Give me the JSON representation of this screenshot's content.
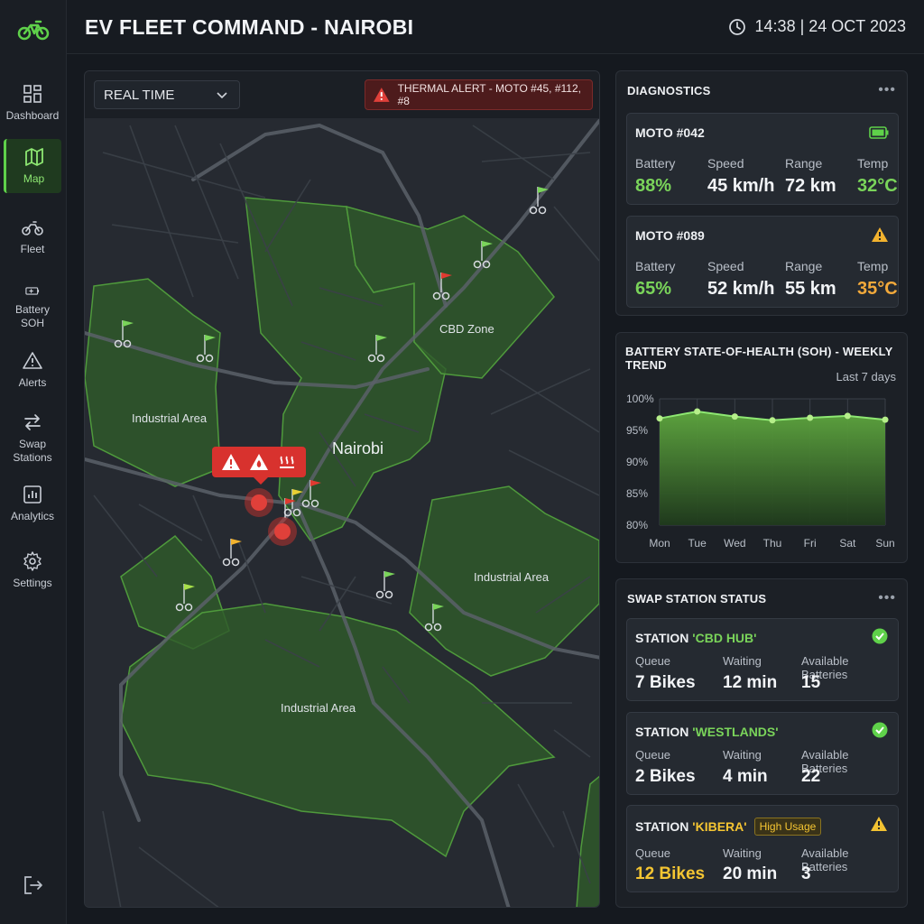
{
  "header": {
    "title": "EV FLEET COMMAND - NAIROBI",
    "clock": "14:38 | 24 OCT 2023"
  },
  "sidebar": {
    "items": [
      {
        "label": "Dashboard",
        "icon": "dashboard-icon"
      },
      {
        "label": "Map",
        "icon": "map-icon",
        "active": true
      },
      {
        "label": "Fleet",
        "icon": "motorcycle-icon"
      },
      {
        "label": "Battery SOH",
        "icon": "battery-icon"
      },
      {
        "label": "Alerts",
        "icon": "warning-icon"
      },
      {
        "label": "Swap\nStations",
        "icon": "swap-icon"
      },
      {
        "label": "Analytics",
        "icon": "analytics-icon"
      },
      {
        "label": "Settings",
        "icon": "gear-icon"
      }
    ]
  },
  "map": {
    "mode_select": "REAL TIME",
    "thermal_alert": "THERMAL ALERT - MOTO #45, #112, #8",
    "labels": {
      "cbd_zone": "CBD Zone",
      "industrial_west": "Industrial Area",
      "nairobi": "Nairobi",
      "industrial_east": "Industrial Area",
      "industrial_south": "Industrial Area"
    }
  },
  "diagnostics": {
    "title": "DIAGNOSTICS",
    "more": "•••",
    "labels": {
      "battery": "Battery",
      "speed": "Speed",
      "range": "Range",
      "temp": "Temp"
    },
    "vehicles": [
      {
        "name": "MOTO #042",
        "battery": "88%",
        "speed": "45 km/h",
        "range": "72 km",
        "temp": "32°C",
        "status_icon": "battery-full-icon"
      },
      {
        "name": "MOTO #089",
        "battery": "65%",
        "speed": "52 km/h",
        "range": "55 km",
        "temp": "35°C",
        "status_icon": "warning-icon"
      }
    ]
  },
  "soh_chart": {
    "title": "BATTERY STATE-OF-HEALTH (SOH) - WEEKLY TREND",
    "period": "Last 7 days"
  },
  "chart_data": {
    "type": "area",
    "title": "BATTERY STATE-OF-HEALTH (SOH) - WEEKLY TREND",
    "categories": [
      "Mon",
      "Tue",
      "Wed",
      "Thu",
      "Fri",
      "Sat",
      "Sun"
    ],
    "values": [
      96.9,
      98.0,
      97.2,
      96.6,
      97.0,
      97.3,
      96.7
    ],
    "yticks": [
      "100%",
      "95%",
      "90%",
      "85%",
      "80%"
    ],
    "ylim": [
      80,
      100
    ],
    "grid": true,
    "color": "#7ad45a"
  },
  "swap_stations": {
    "title": "SWAP STATION STATUS",
    "more": "•••",
    "labels": {
      "queue": "Queue",
      "waiting": "Waiting",
      "available": "Available Batteries"
    },
    "stations": [
      {
        "prefix": "STATION ",
        "name": "'CBD HUB'",
        "queue": "7 Bikes",
        "waiting": "12 min",
        "available": "15",
        "status_icon": "check-circle-icon",
        "badge": ""
      },
      {
        "prefix": "STATION ",
        "name": "'WESTLANDS'",
        "queue": "2 Bikes",
        "waiting": "4 min",
        "available": "22",
        "status_icon": "check-circle-icon",
        "badge": ""
      },
      {
        "prefix": "STATION ",
        "name": "'KIBERA'",
        "queue": "12 Bikes",
        "waiting": "20 min",
        "available": "3",
        "status_icon": "warning-icon",
        "badge": "High Usage"
      }
    ]
  },
  "colors": {
    "accent": "#5fd14a",
    "warning": "#f2a93b",
    "alert": "#d8322e",
    "zone_fill": "#2f5a2b"
  }
}
